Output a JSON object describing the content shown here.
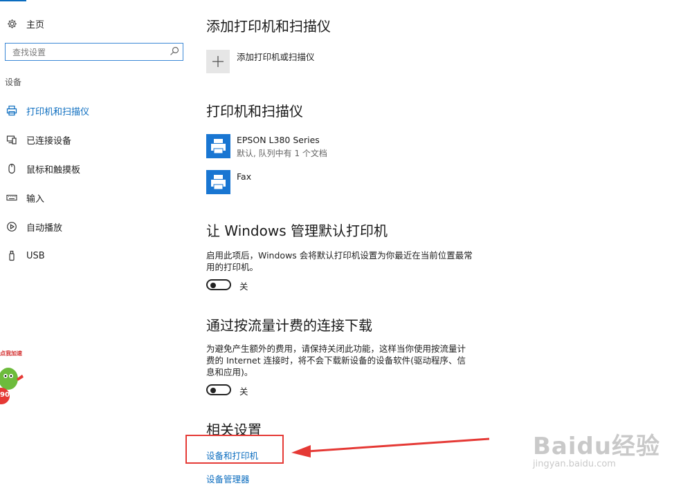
{
  "sidebar": {
    "home_label": "主页",
    "search_placeholder": "查找设置",
    "section_label": "设备",
    "items": [
      {
        "label": "打印机和扫描仪",
        "icon": "printer-icon",
        "active": true
      },
      {
        "label": "已连接设备",
        "icon": "connected-devices-icon",
        "active": false
      },
      {
        "label": "鼠标和触摸板",
        "icon": "mouse-icon",
        "active": false
      },
      {
        "label": "输入",
        "icon": "keyboard-icon",
        "active": false
      },
      {
        "label": "自动播放",
        "icon": "autoplay-icon",
        "active": false
      },
      {
        "label": "USB",
        "icon": "usb-icon",
        "active": false
      }
    ]
  },
  "main": {
    "add_heading": "添加打印机和扫描仪",
    "add_button_label": "添加打印机或扫描仪",
    "printers_heading": "打印机和扫描仪",
    "printers": [
      {
        "name": "EPSON L380 Series",
        "status": "默认, 队列中有 1 个文档"
      },
      {
        "name": "Fax",
        "status": ""
      }
    ],
    "manage_default": {
      "heading": "让 Windows 管理默认打印机",
      "description": "启用此项后，Windows 会将默认打印机设置为你最近在当前位置最常用的打印机。",
      "toggle_state": "关"
    },
    "metered": {
      "heading": "通过按流量计费的连接下载",
      "description": "为避免产生额外的费用，请保持关闭此功能，这样当你使用按流量计费的 Internet 连接时，将不会下载新设备的设备软件(驱动程序、信息和应用)。",
      "toggle_state": "关"
    },
    "related": {
      "heading": "相关设置",
      "links": [
        "设备和打印机",
        "设备管理器"
      ]
    }
  },
  "overlay": {
    "watermark_logo": "Baidu经验",
    "watermark_url": "jingyan.baidu.com",
    "badge_text": "点我加速",
    "badge_number": "90"
  },
  "colors": {
    "accent": "#0a6cbf",
    "annotation_red": "#e53935",
    "printer_tile": "#1976d2"
  }
}
